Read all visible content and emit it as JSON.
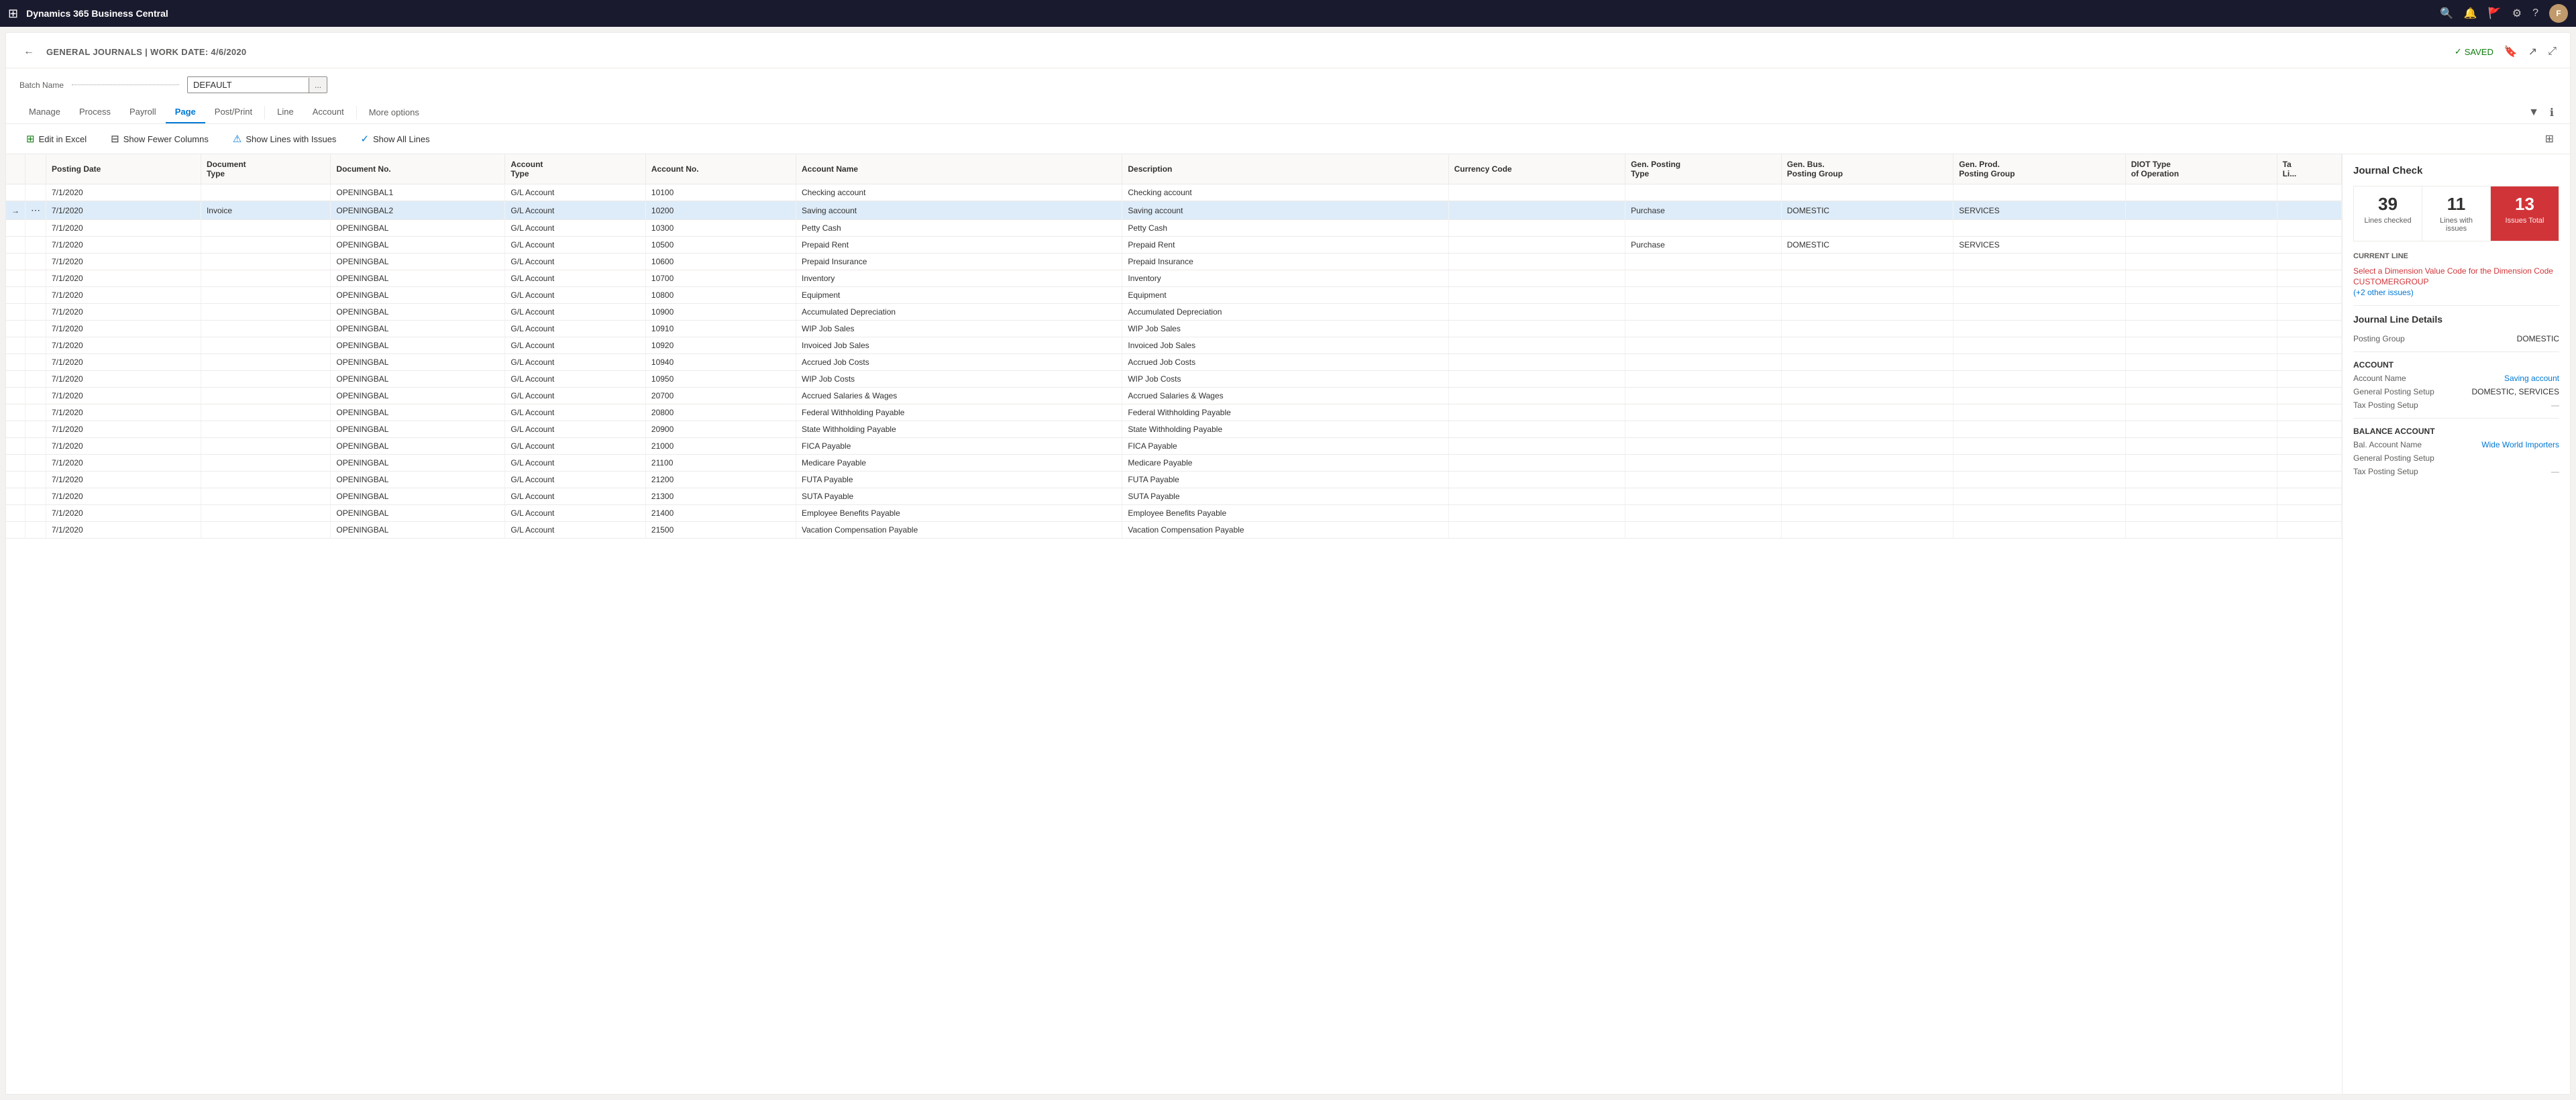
{
  "topNav": {
    "appName": "Dynamics 365 Business Central",
    "avatarInitial": "F"
  },
  "pageHeader": {
    "title": "GENERAL JOURNALS | WORK DATE: 4/6/2020",
    "savedLabel": "SAVED",
    "backArrow": "←"
  },
  "batchName": {
    "label": "Batch Name",
    "value": "DEFAULT",
    "dotsLabel": "..."
  },
  "tabs": [
    {
      "label": "Manage",
      "active": false
    },
    {
      "label": "Process",
      "active": false
    },
    {
      "label": "Payroll",
      "active": false
    },
    {
      "label": "Page",
      "active": true
    },
    {
      "label": "Post/Print",
      "active": false
    },
    {
      "label": "Line",
      "active": false
    },
    {
      "label": "Account",
      "active": false
    }
  ],
  "moreOptions": "More options",
  "actionBar": {
    "editInExcel": "Edit in Excel",
    "showFewerColumns": "Show Fewer Columns",
    "showLinesWithIssues": "Show Lines with Issues",
    "showAllLines": "Show All Lines"
  },
  "tableColumns": [
    "",
    "",
    "Posting Date",
    "Document Type",
    "Document No.",
    "Account Type",
    "Account No.",
    "Account Name",
    "Description",
    "Currency Code",
    "Gen. Posting Type",
    "Gen. Bus. Posting Group",
    "Gen. Prod. Posting Group",
    "DIOT Type of Operation",
    "Ta Li..."
  ],
  "tableRows": [
    {
      "arrow": "",
      "more": "",
      "postingDate": "7/1/2020",
      "docType": "",
      "docNo": "OPENINGBAL1",
      "acctType": "G/L Account",
      "acctNo": "10100",
      "acctName": "Checking account",
      "description": "Checking account",
      "currency": "",
      "genPostingType": "",
      "genBusPostingGroup": "",
      "genProdPostingGroup": "",
      "diotType": "",
      "ta": ""
    },
    {
      "arrow": "→",
      "more": "⋯",
      "postingDate": "7/1/2020",
      "docType": "Invoice",
      "docNo": "OPENINGBAL2",
      "acctType": "G/L Account",
      "acctNo": "10200",
      "acctName": "Saving account",
      "description": "Saving account",
      "currency": "",
      "genPostingType": "Purchase",
      "genBusPostingGroup": "DOMESTIC",
      "genProdPostingGroup": "SERVICES",
      "diotType": "",
      "ta": "",
      "selected": true
    },
    {
      "arrow": "",
      "more": "",
      "postingDate": "7/1/2020",
      "docType": "",
      "docNo": "OPENINGBAL",
      "acctType": "G/L Account",
      "acctNo": "10300",
      "acctName": "Petty Cash",
      "description": "Petty Cash",
      "currency": "",
      "genPostingType": "",
      "genBusPostingGroup": "",
      "genProdPostingGroup": "",
      "diotType": "",
      "ta": ""
    },
    {
      "arrow": "",
      "more": "",
      "postingDate": "7/1/2020",
      "docType": "",
      "docNo": "OPENINGBAL",
      "acctType": "G/L Account",
      "acctNo": "10500",
      "acctName": "Prepaid Rent",
      "description": "Prepaid Rent",
      "currency": "",
      "genPostingType": "Purchase",
      "genBusPostingGroup": "DOMESTIC",
      "genProdPostingGroup": "SERVICES",
      "diotType": "",
      "ta": ""
    },
    {
      "arrow": "",
      "more": "",
      "postingDate": "7/1/2020",
      "docType": "",
      "docNo": "OPENINGBAL",
      "acctType": "G/L Account",
      "acctNo": "10600",
      "acctName": "Prepaid Insurance",
      "description": "Prepaid Insurance",
      "currency": "",
      "genPostingType": "",
      "genBusPostingGroup": "",
      "genProdPostingGroup": "",
      "diotType": "",
      "ta": ""
    },
    {
      "arrow": "",
      "more": "",
      "postingDate": "7/1/2020",
      "docType": "",
      "docNo": "OPENINGBAL",
      "acctType": "G/L Account",
      "acctNo": "10700",
      "acctName": "Inventory",
      "description": "Inventory",
      "currency": "",
      "genPostingType": "",
      "genBusPostingGroup": "",
      "genProdPostingGroup": "",
      "diotType": "",
      "ta": ""
    },
    {
      "arrow": "",
      "more": "",
      "postingDate": "7/1/2020",
      "docType": "",
      "docNo": "OPENINGBAL",
      "acctType": "G/L Account",
      "acctNo": "10800",
      "acctName": "Equipment",
      "description": "Equipment",
      "currency": "",
      "genPostingType": "",
      "genBusPostingGroup": "",
      "genProdPostingGroup": "",
      "diotType": "",
      "ta": ""
    },
    {
      "arrow": "",
      "more": "",
      "postingDate": "7/1/2020",
      "docType": "",
      "docNo": "OPENINGBAL",
      "acctType": "G/L Account",
      "acctNo": "10900",
      "acctName": "Accumulated Depreciation",
      "description": "Accumulated Depreciation",
      "currency": "",
      "genPostingType": "",
      "genBusPostingGroup": "",
      "genProdPostingGroup": "",
      "diotType": "",
      "ta": ""
    },
    {
      "arrow": "",
      "more": "",
      "postingDate": "7/1/2020",
      "docType": "",
      "docNo": "OPENINGBAL",
      "acctType": "G/L Account",
      "acctNo": "10910",
      "acctName": "WIP Job Sales",
      "description": "WIP Job Sales",
      "currency": "",
      "genPostingType": "",
      "genBusPostingGroup": "",
      "genProdPostingGroup": "",
      "diotType": "",
      "ta": ""
    },
    {
      "arrow": "",
      "more": "",
      "postingDate": "7/1/2020",
      "docType": "",
      "docNo": "OPENINGBAL",
      "acctType": "G/L Account",
      "acctNo": "10920",
      "acctName": "Invoiced Job Sales",
      "description": "Invoiced Job Sales",
      "currency": "",
      "genPostingType": "",
      "genBusPostingGroup": "",
      "genProdPostingGroup": "",
      "diotType": "",
      "ta": ""
    },
    {
      "arrow": "",
      "more": "",
      "postingDate": "7/1/2020",
      "docType": "",
      "docNo": "OPENINGBAL",
      "acctType": "G/L Account",
      "acctNo": "10940",
      "acctName": "Accrued Job Costs",
      "description": "Accrued Job Costs",
      "currency": "",
      "genPostingType": "",
      "genBusPostingGroup": "",
      "genProdPostingGroup": "",
      "diotType": "",
      "ta": ""
    },
    {
      "arrow": "",
      "more": "",
      "postingDate": "7/1/2020",
      "docType": "",
      "docNo": "OPENINGBAL",
      "acctType": "G/L Account",
      "acctNo": "10950",
      "acctName": "WIP Job Costs",
      "description": "WIP Job Costs",
      "currency": "",
      "genPostingType": "",
      "genBusPostingGroup": "",
      "genProdPostingGroup": "",
      "diotType": "",
      "ta": ""
    },
    {
      "arrow": "",
      "more": "",
      "postingDate": "7/1/2020",
      "docType": "",
      "docNo": "OPENINGBAL",
      "acctType": "G/L Account",
      "acctNo": "20700",
      "acctName": "Accrued Salaries & Wages",
      "description": "Accrued Salaries & Wages",
      "currency": "",
      "genPostingType": "",
      "genBusPostingGroup": "",
      "genProdPostingGroup": "",
      "diotType": "",
      "ta": ""
    },
    {
      "arrow": "",
      "more": "",
      "postingDate": "7/1/2020",
      "docType": "",
      "docNo": "OPENINGBAL",
      "acctType": "G/L Account",
      "acctNo": "20800",
      "acctName": "Federal Withholding Payable",
      "description": "Federal Withholding Payable",
      "currency": "",
      "genPostingType": "",
      "genBusPostingGroup": "",
      "genProdPostingGroup": "",
      "diotType": "",
      "ta": ""
    },
    {
      "arrow": "",
      "more": "",
      "postingDate": "7/1/2020",
      "docType": "",
      "docNo": "OPENINGBAL",
      "acctType": "G/L Account",
      "acctNo": "20900",
      "acctName": "State Withholding Payable",
      "description": "State Withholding Payable",
      "currency": "",
      "genPostingType": "",
      "genBusPostingGroup": "",
      "genProdPostingGroup": "",
      "diotType": "",
      "ta": ""
    },
    {
      "arrow": "",
      "more": "",
      "postingDate": "7/1/2020",
      "docType": "",
      "docNo": "OPENINGBAL",
      "acctType": "G/L Account",
      "acctNo": "21000",
      "acctName": "FICA Payable",
      "description": "FICA Payable",
      "currency": "",
      "genPostingType": "",
      "genBusPostingGroup": "",
      "genProdPostingGroup": "",
      "diotType": "",
      "ta": ""
    },
    {
      "arrow": "",
      "more": "",
      "postingDate": "7/1/2020",
      "docType": "",
      "docNo": "OPENINGBAL",
      "acctType": "G/L Account",
      "acctNo": "21100",
      "acctName": "Medicare Payable",
      "description": "Medicare Payable",
      "currency": "",
      "genPostingType": "",
      "genBusPostingGroup": "",
      "genProdPostingGroup": "",
      "diotType": "",
      "ta": ""
    },
    {
      "arrow": "",
      "more": "",
      "postingDate": "7/1/2020",
      "docType": "",
      "docNo": "OPENINGBAL",
      "acctType": "G/L Account",
      "acctNo": "21200",
      "acctName": "FUTA Payable",
      "description": "FUTA Payable",
      "currency": "",
      "genPostingType": "",
      "genBusPostingGroup": "",
      "genProdPostingGroup": "",
      "diotType": "",
      "ta": ""
    },
    {
      "arrow": "",
      "more": "",
      "postingDate": "7/1/2020",
      "docType": "",
      "docNo": "OPENINGBAL",
      "acctType": "G/L Account",
      "acctNo": "21300",
      "acctName": "SUTA Payable",
      "description": "SUTA Payable",
      "currency": "",
      "genPostingType": "",
      "genBusPostingGroup": "",
      "genProdPostingGroup": "",
      "diotType": "",
      "ta": ""
    },
    {
      "arrow": "",
      "more": "",
      "postingDate": "7/1/2020",
      "docType": "",
      "docNo": "OPENINGBAL",
      "acctType": "G/L Account",
      "acctNo": "21400",
      "acctName": "Employee Benefits Payable",
      "description": "Employee Benefits Payable",
      "currency": "",
      "genPostingType": "",
      "genBusPostingGroup": "",
      "genProdPostingGroup": "",
      "diotType": "",
      "ta": ""
    },
    {
      "arrow": "",
      "more": "",
      "postingDate": "7/1/2020",
      "docType": "",
      "docNo": "OPENINGBAL",
      "acctType": "G/L Account",
      "acctNo": "21500",
      "acctName": "Vacation Compensation Payable",
      "description": "Vacation Compensation Payable",
      "currency": "",
      "genPostingType": "",
      "genBusPostingGroup": "",
      "genProdPostingGroup": "",
      "diotType": "",
      "ta": ""
    }
  ],
  "journalCheck": {
    "title": "Journal Check",
    "stats": {
      "checked": {
        "number": "39",
        "label": "Lines checked"
      },
      "withIssues": {
        "number": "11",
        "label": "Lines with issues"
      },
      "issuesTotal": {
        "number": "13",
        "label": "Issues Total"
      }
    },
    "currentLineTitle": "CURRENT LINE",
    "currentLineError": "Select a Dimension Value Code for the Dimension Code CUSTOMERGROUP",
    "currentLineMore": "(+2 other issues)",
    "journalLineDetailsTitle": "Journal Line Details",
    "postingGroup": {
      "label": "Posting Group",
      "value": "DOMESTIC"
    },
    "accountSection": {
      "title": "ACCOUNT",
      "accountName": {
        "label": "Account Name",
        "value": "Saving account"
      },
      "generalPostingSetup": {
        "label": "General Posting Setup",
        "value": "DOMESTIC, SERVICES"
      },
      "taxPostingSetup": {
        "label": "Tax Posting Setup",
        "value": "—"
      }
    },
    "balanceAccountSection": {
      "title": "BALANCE ACCOUNT",
      "balAccountName": {
        "label": "Bal. Account Name",
        "value": "Wide World Importers"
      },
      "generalPostingSetup": {
        "label": "General Posting Setup",
        "value": ""
      },
      "taxPostingSetup": {
        "label": "Tax Posting Setup",
        "value": "—"
      }
    }
  }
}
